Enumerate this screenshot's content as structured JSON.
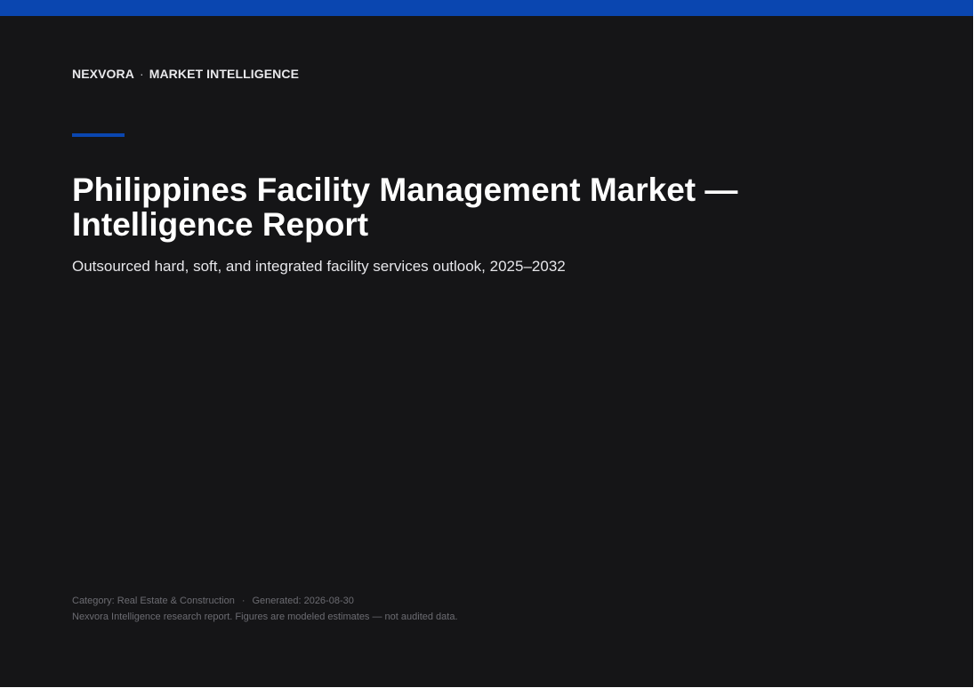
{
  "header": {
    "brand": "NEXVORA",
    "separator": "·",
    "section": "MARKET INTELLIGENCE"
  },
  "report": {
    "title_line1": "Philippines Facility Management Market —",
    "title_line2": "Intelligence Report",
    "subtitle": "Outsourced hard, soft, and integrated facility services outlook, 2025–2032"
  },
  "footer": {
    "category": "Category: Real Estate & Construction",
    "separator": "·",
    "generated": "Generated: 2026-08-30",
    "disclaimer": "Nexvora Intelligence research report. Figures are modeled estimates — not audited data."
  },
  "colors": {
    "accent": "#0a46b0",
    "background": "#151517"
  }
}
